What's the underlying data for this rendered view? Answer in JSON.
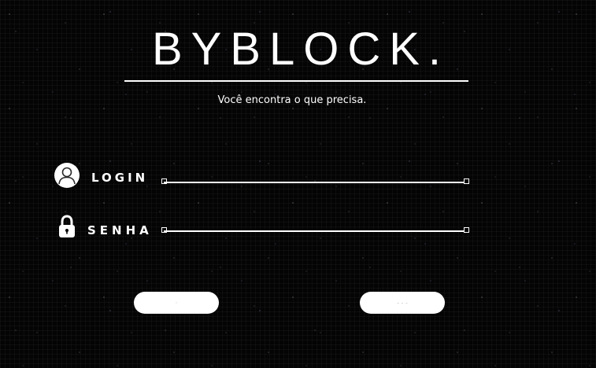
{
  "brand": {
    "title": "BYBLOCK.",
    "tagline": "Você encontra o que precisa."
  },
  "form": {
    "login": {
      "label": "LOGIN",
      "icon": "user-avatar-icon",
      "value": "",
      "placeholder": ""
    },
    "senha": {
      "label": "SENHA",
      "icon": "padlock-icon",
      "value": "",
      "placeholder": ""
    }
  },
  "buttons": {
    "left_label": "·",
    "right_label": "- - -"
  },
  "colors": {
    "background": "#040404",
    "foreground": "#ffffff"
  }
}
